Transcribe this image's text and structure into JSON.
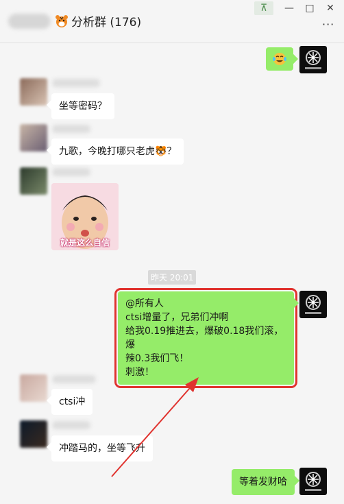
{
  "window": {
    "title": "分析群 (176)",
    "controls": {
      "pin": "⊼",
      "minimize": "—",
      "maximize": "□",
      "close": "✕"
    },
    "more": "···"
  },
  "messages": {
    "m2": "坐等密码？",
    "m3": "九歌，今晚打哪只老虎🐯？",
    "m4_sticker_caption": "就是这么自信",
    "timestamp": "昨天 20:01",
    "m5_lines": [
      "@所有人",
      " ctsi增量了，兄弟们冲啊",
      "给我0.19推进去，爆破0.18我们滚，爆",
      "辣0.3我们飞！",
      "刺激！"
    ],
    "m6": "ctsi冲",
    "m7": "冲踏马的，坐等飞升",
    "m8": "等着发财哈"
  },
  "colors": {
    "self_bubble": "#95ec69",
    "other_bubble": "#ffffff",
    "annotation": "#e0332f"
  }
}
